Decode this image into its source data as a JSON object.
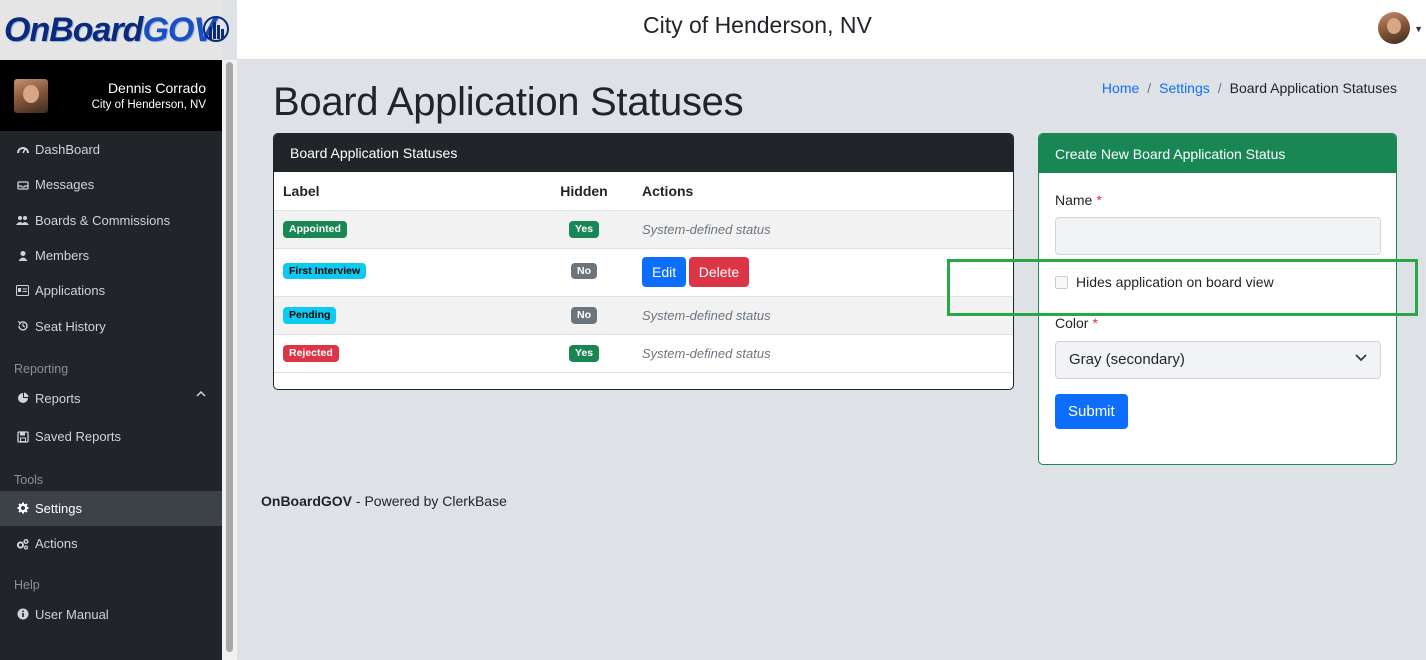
{
  "logo": {
    "part1": "OnBoard",
    "part2": "GOV"
  },
  "user": {
    "name": "Dennis Corrado",
    "city": "City of Henderson, NV"
  },
  "header": {
    "title": "City of Henderson, NV"
  },
  "sidebar": {
    "items": [
      {
        "label": "DashBoard",
        "icon": "dashboard-icon"
      },
      {
        "label": "Messages",
        "icon": "inbox-icon"
      },
      {
        "label": "Boards & Commissions",
        "icon": "users-icon"
      },
      {
        "label": "Members",
        "icon": "user-icon"
      },
      {
        "label": "Applications",
        "icon": "id-card-icon"
      },
      {
        "label": "Seat History",
        "icon": "history-icon"
      }
    ],
    "sections": {
      "reporting": "Reporting",
      "tools": "Tools",
      "help": "Help"
    },
    "reporting_items": [
      {
        "label": "Reports",
        "icon": "pie-chart-icon"
      },
      {
        "label": "Saved Reports",
        "icon": "save-icon"
      }
    ],
    "tools_items": [
      {
        "label": "Settings",
        "icon": "gear-icon",
        "active": true
      },
      {
        "label": "Actions",
        "icon": "gears-icon"
      }
    ],
    "help_items": [
      {
        "label": "User Manual",
        "icon": "info-icon"
      }
    ]
  },
  "page": {
    "title": "Board Application Statuses",
    "breadcrumb": [
      "Home",
      "Settings",
      "Board Application Statuses"
    ]
  },
  "list_card": {
    "title": "Board Application Statuses",
    "columns": [
      "Label",
      "Hidden",
      "Actions"
    ],
    "rows": [
      {
        "label": "Appointed",
        "label_color": "#198754",
        "hidden": "Yes",
        "action_text": "System-defined status"
      },
      {
        "label": "First Interview",
        "label_color": "#0dcaf0",
        "hidden": "No",
        "edit": "Edit",
        "delete": "Delete"
      },
      {
        "label": "Pending",
        "label_color": "#0dcaf0",
        "hidden": "No",
        "action_text": "System-defined status"
      },
      {
        "label": "Rejected",
        "label_color": "#dc3545",
        "hidden": "Yes",
        "action_text": "System-defined status"
      }
    ]
  },
  "form_card": {
    "title": "Create New Board Application Status",
    "name_label": "Name",
    "required_mark": "*",
    "name_value": "",
    "checkbox_label": "Hides application on board view",
    "checkbox_checked": false,
    "color_label": "Color",
    "color_value": "Gray (secondary)",
    "submit": "Submit"
  },
  "footer": {
    "brand": "OnBoardGOV",
    "text": " - Powered by ClerkBase"
  },
  "colors": {
    "accent": "#0d6efd",
    "success": "#198754",
    "danger": "#dc3545",
    "highlight": "#28a745"
  }
}
